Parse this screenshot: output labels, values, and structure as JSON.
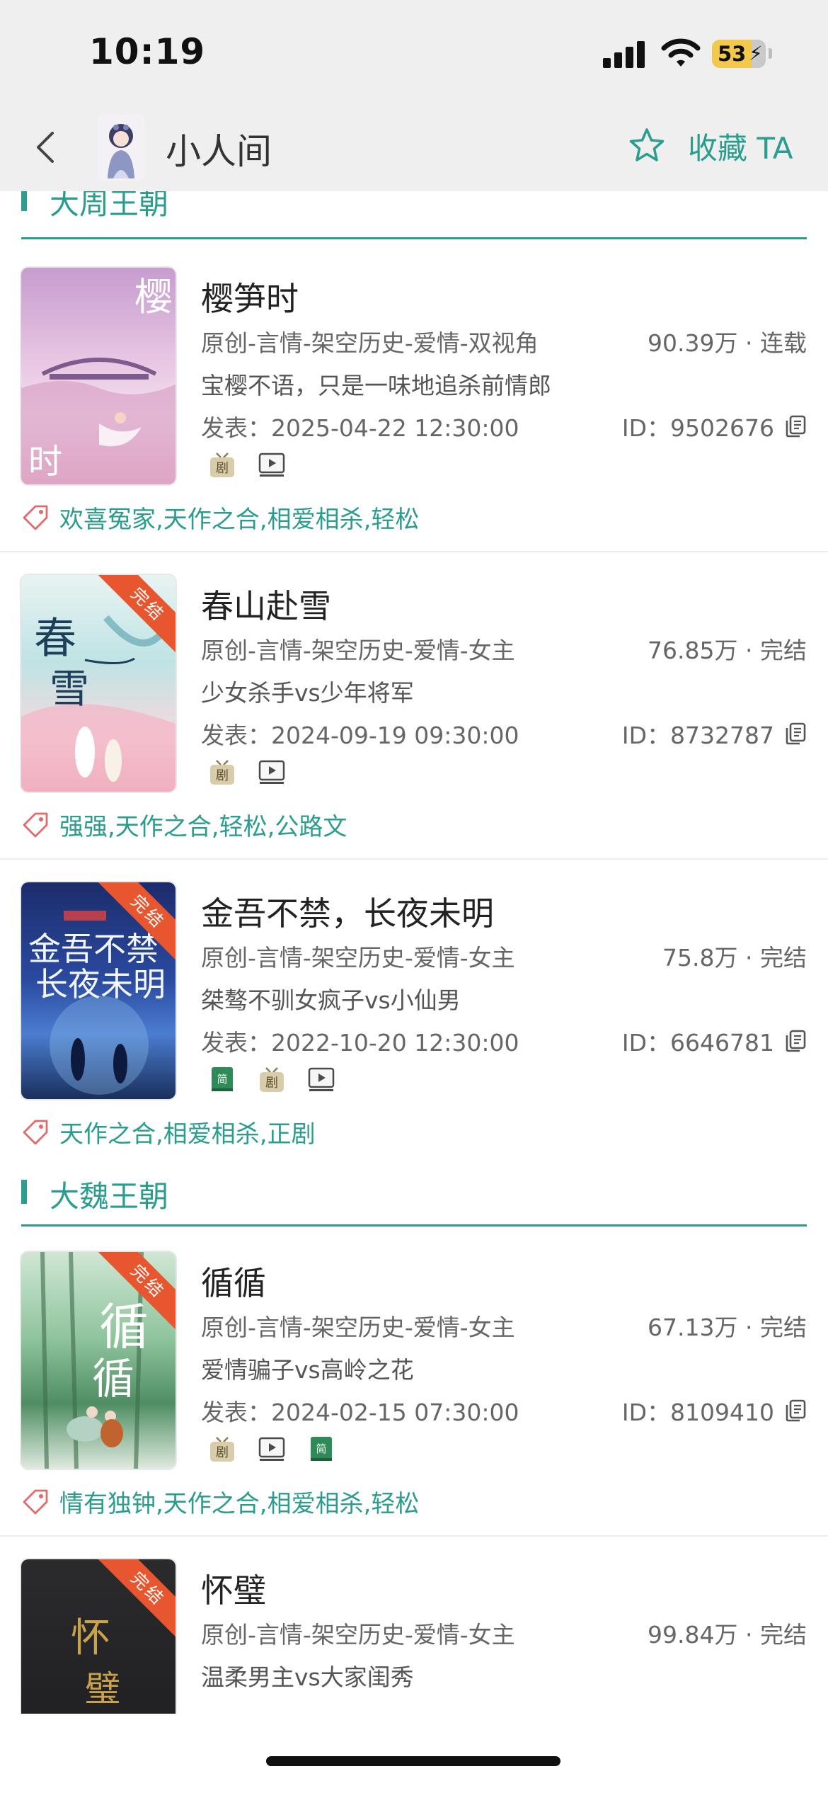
{
  "status": {
    "time": "10:19",
    "battery": "53"
  },
  "nav": {
    "title": "小人间",
    "favorite_label": "收藏 TA"
  },
  "colors": {
    "accent": "#2a9d8f",
    "ribbon": "#e8562f",
    "tag_icon": "#e06b6b"
  },
  "sections": [
    {
      "name": "大周王朝",
      "books": [
        {
          "title": "樱笋时",
          "meta": "原创-言情-架空历史-爱情-双视角",
          "stats": "90.39万 · 连载",
          "desc": "宝樱不语，只是一味地追杀前情郎",
          "date": "发表：2025-04-22 12:30:00",
          "id": "ID：9502676",
          "tags": "欢喜冤家,天作之合,相爱相杀,轻松",
          "badges": [
            "drama-icon",
            "video-icon"
          ],
          "ribbon": ""
        },
        {
          "title": "春山赴雪",
          "meta": "原创-言情-架空历史-爱情-女主",
          "stats": "76.85万 · 完结",
          "desc": "少女杀手vs少年将军",
          "date": "发表：2024-09-19 09:30:00",
          "id": "ID：8732787",
          "tags": "强强,天作之合,轻松,公路文",
          "badges": [
            "drama-icon",
            "video-icon"
          ],
          "ribbon": "完结"
        },
        {
          "title": "金吾不禁，长夜未明",
          "meta": "原创-言情-架空历史-爱情-女主",
          "stats": "75.8万 · 完结",
          "desc": "桀骜不驯女疯子vs小仙男",
          "date": "发表：2022-10-20 12:30:00",
          "id": "ID：6646781",
          "tags": "天作之合,相爱相杀,正剧",
          "badges": [
            "simplified-book-icon",
            "drama-icon",
            "video-icon"
          ],
          "ribbon": "完结"
        }
      ]
    },
    {
      "name": "大魏王朝",
      "books": [
        {
          "title": "循循",
          "meta": "原创-言情-架空历史-爱情-女主",
          "stats": "67.13万 · 完结",
          "desc": "爱情骗子vs高岭之花",
          "date": "发表：2024-02-15 07:30:00",
          "id": "ID：8109410",
          "tags": "情有独钟,天作之合,相爱相杀,轻松",
          "badges": [
            "drama-icon",
            "video-icon",
            "simplified-book-icon"
          ],
          "ribbon": "完结"
        },
        {
          "title": "怀璧",
          "meta": "原创-言情-架空历史-爱情-女主",
          "stats": "99.84万 · 完结",
          "desc": "温柔男主vs大家闺秀",
          "date": "",
          "id": "",
          "tags": "",
          "badges": [],
          "ribbon": "完结"
        }
      ]
    }
  ]
}
